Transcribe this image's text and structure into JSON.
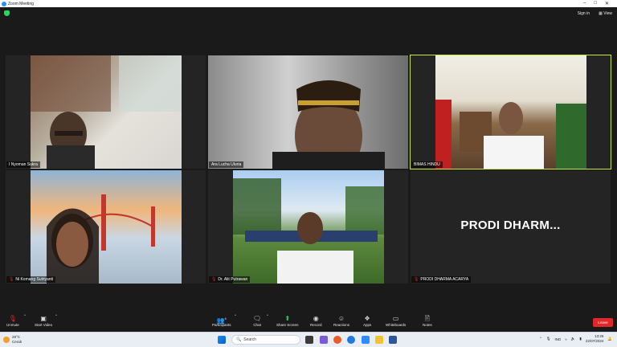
{
  "window": {
    "title": "Zoom Meeting"
  },
  "header": {
    "sign_in": "Sign in",
    "view": "View"
  },
  "participants_tiles": [
    {
      "name": "I Nyoman Sukra",
      "muted": false
    },
    {
      "name": "Ara Lucha Uluria",
      "muted": false
    },
    {
      "name": "BIMAS HINDU",
      "muted": false,
      "active_speaker": true
    },
    {
      "name": "Ni Komang Sulriyanti",
      "muted": true
    },
    {
      "name": "Dr. Alit Putrawan",
      "muted": true
    },
    {
      "name": "PRODI DHARMA ACARYA",
      "muted": true,
      "video_off": true,
      "display_label": "PRODI  DHARM..."
    }
  ],
  "toolbar": {
    "unmute": "Unmute",
    "start_video": "Start Video",
    "participants": "Participants",
    "participants_count": "6",
    "chat": "Chat",
    "share_screen": "Share Screen",
    "record": "Record",
    "reactions": "Reactions",
    "apps": "Apps",
    "whiteboards": "Whiteboards",
    "notes": "Notes",
    "leave": "Leave"
  },
  "taskbar": {
    "weather_temp": "28°C",
    "weather_desc": "Cerah",
    "search_placeholder": "Search",
    "language": "IND",
    "time": "13:26",
    "date": "22/07/2024"
  },
  "colors": {
    "active_border": "#c9e53c",
    "leave": "#e02828",
    "share": "#23d959",
    "muted_mic": "#e02828"
  }
}
